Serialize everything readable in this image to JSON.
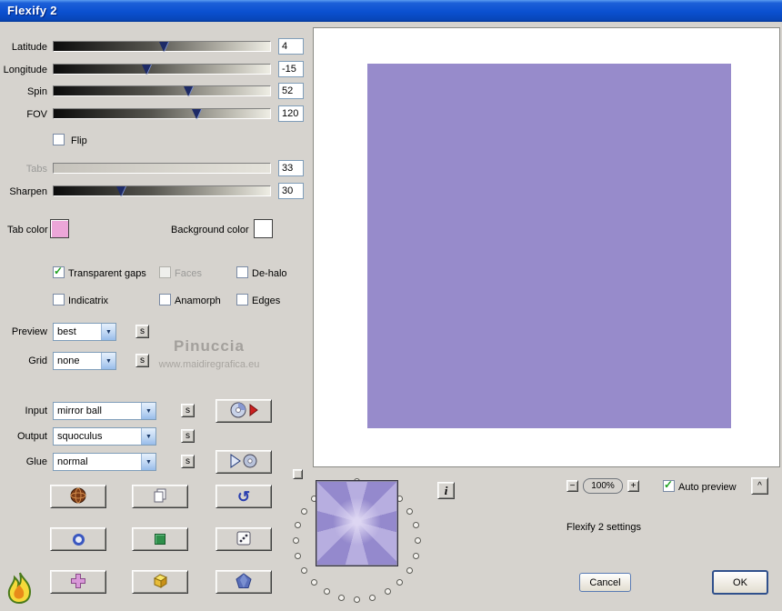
{
  "window": {
    "title": "Flexify 2"
  },
  "glyphs": {
    "dropdown": "▼",
    "check": "✓",
    "undo": "↺"
  },
  "sliders": {
    "latitude": {
      "label": "Latitude",
      "value": "4",
      "percent": 51
    },
    "longitude": {
      "label": "Longitude",
      "value": "-15",
      "percent": 43
    },
    "spin": {
      "label": "Spin",
      "value": "52",
      "percent": 62
    },
    "fov": {
      "label": "FOV",
      "value": "120",
      "percent": 66
    },
    "tabs": {
      "label": "Tabs",
      "value": "33",
      "percent": 0
    },
    "sharpen": {
      "label": "Sharpen",
      "value": "30",
      "percent": 31
    }
  },
  "flip": {
    "label": "Flip",
    "mark": ""
  },
  "color_pickers": {
    "tab": {
      "label": "Tab color",
      "swatch": "#eca6d8"
    },
    "background": {
      "label": "Background color",
      "swatch": "#ffffff"
    }
  },
  "options": {
    "transparent_gaps": {
      "label": "Transparent gaps",
      "mark": "✓"
    },
    "faces": {
      "label": "Faces",
      "mark": ""
    },
    "dehalo": {
      "label": "De-halo",
      "mark": ""
    },
    "indicatrix": {
      "label": "Indicatrix",
      "mark": ""
    },
    "anamorph": {
      "label": "Anamorph",
      "mark": ""
    },
    "edges": {
      "label": "Edges",
      "mark": ""
    }
  },
  "selects": {
    "preview": {
      "label": "Preview",
      "value": "best"
    },
    "grid": {
      "label": "Grid",
      "value": "none"
    },
    "input": {
      "label": "Input",
      "value": "mirror ball"
    },
    "output": {
      "label": "Output",
      "value": "squoculus"
    },
    "glue": {
      "label": "Glue",
      "value": "normal"
    }
  },
  "s_button": "s",
  "watermark": {
    "line1": "Pinuccia",
    "line2": "www.maidiregrafica.eu"
  },
  "preview_panel": {
    "zoom_out": "−",
    "zoom_level": "100%",
    "zoom_in": "+",
    "auto_preview": {
      "label": "Auto preview",
      "mark": "✓"
    },
    "collapse": "^",
    "info": "i",
    "settings_text": "Flexify 2 settings"
  },
  "actions": {
    "cancel": "Cancel",
    "ok": "OK"
  }
}
